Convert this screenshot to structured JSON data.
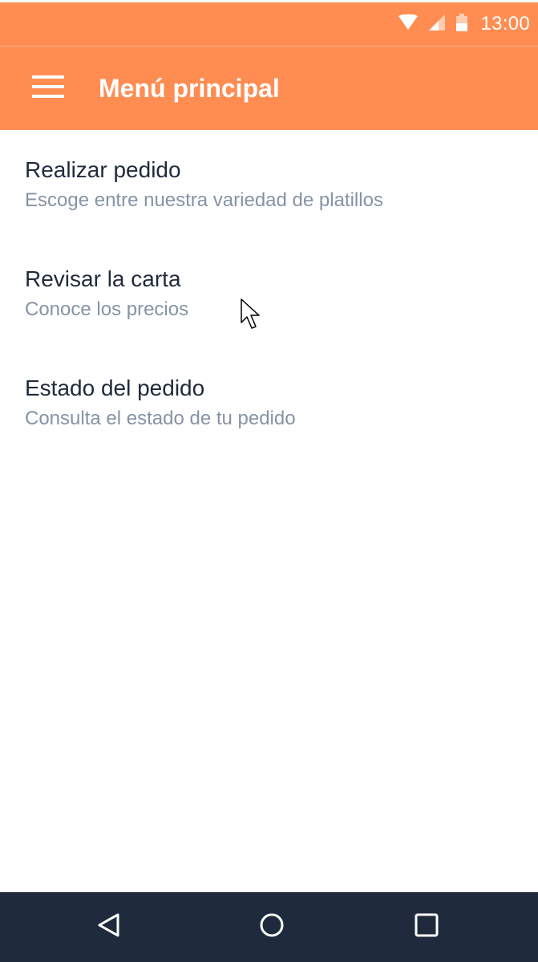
{
  "status_bar": {
    "time": "13:00",
    "icons": [
      "wifi-icon",
      "signal-icon",
      "battery-icon"
    ]
  },
  "app_bar": {
    "title": "Menú principal",
    "menu_icon": "hamburger-menu-icon"
  },
  "menu": {
    "items": [
      {
        "title": "Realizar pedido",
        "subtitle": "Escoge entre nuestra variedad de platillos"
      },
      {
        "title": "Revisar la carta",
        "subtitle": "Conoce los precios"
      },
      {
        "title": "Estado del pedido",
        "subtitle": "Consulta el estado de tu pedido"
      }
    ]
  },
  "nav_bar": {
    "icons": [
      "back-icon",
      "home-icon",
      "recent-apps-icon"
    ]
  },
  "colors": {
    "accent": "#ff8d52",
    "title_text": "#1f2a3c",
    "subtitle_text": "#8593a6",
    "nav_bar": "#1f2b3d"
  }
}
